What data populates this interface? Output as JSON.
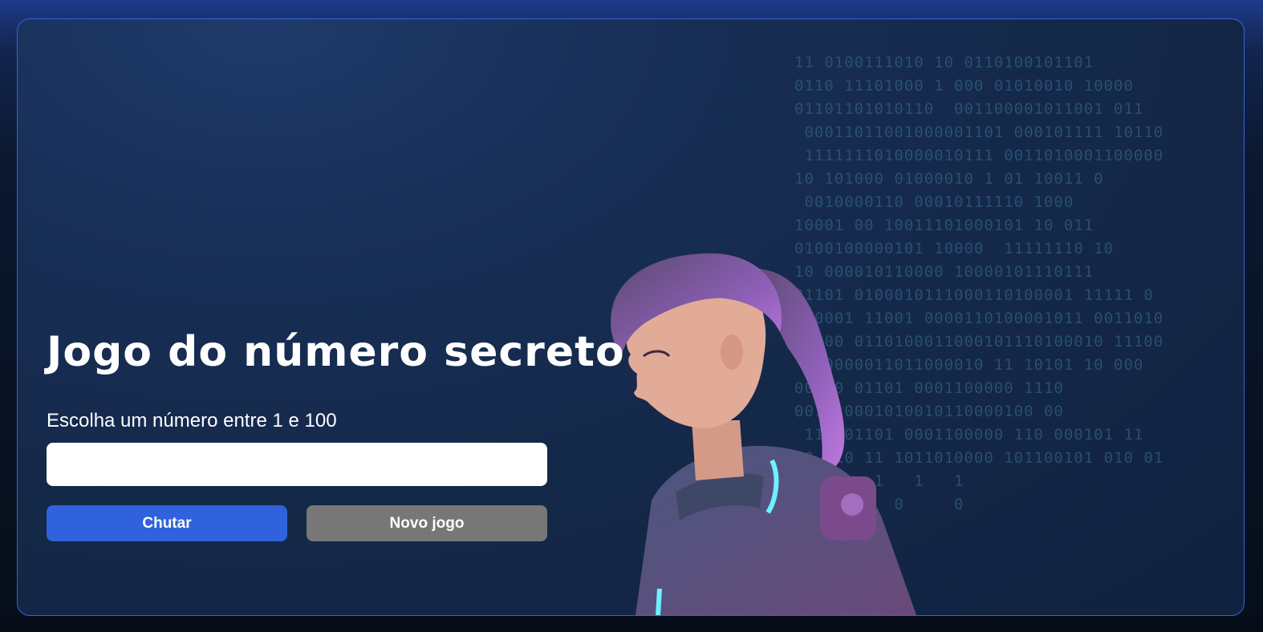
{
  "game": {
    "title": "Jogo do número secreto",
    "prompt": "Escolha um número entre 1 e 100",
    "input_value": "",
    "guess_button": "Chutar",
    "new_game_button": "Novo jogo"
  },
  "illustration": {
    "icon": "astronaut-girl-illustration",
    "binary_background": "11 0100111010 10 0110100101101\n0110 11101000 1 000 01010010 10000\n01101101010110  001100001011001 011\n 00011011001000001101 000101111 10110\n 1111111010000010111 0011010001100000\n10 101000 01000010 1 01 10011 0\n 0010000110 00010111110 1000\n10001 00 10011101000101 10 011\n0100100000101 10000  11111110 10\n10 000010110000 10000101110111\n01101 0100010111000110100001 11111 0\n110001 11001 0000110100001011 0011010\n0 000 0110100011000101110100010 11100\n 110000011011000010 11 10101 10 000\n00000 01101 0001100000 1110\n0011 0001010010110000100 00\n 11 101101 0001100000 110 000101 11\n00 010 11 1011010000 101100101 010 01\n 1 1    1   1   1\n  0       0     0",
    "colors": {
      "accent": "#2f62dc",
      "secondary": "#777777",
      "border": "#3563d8"
    }
  }
}
